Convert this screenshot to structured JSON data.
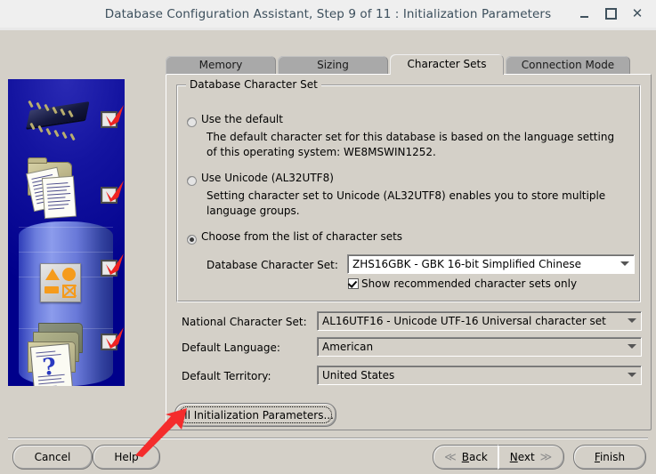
{
  "window": {
    "title": "Database Configuration Assistant, Step 9 of 11 : Initialization Parameters",
    "minimize_label": "",
    "maximize_label": "",
    "close_label": "✕"
  },
  "tabs": [
    {
      "label": "Memory",
      "active": false
    },
    {
      "label": "Sizing",
      "active": false
    },
    {
      "label": "Character Sets",
      "active": true
    },
    {
      "label": "Connection Mode",
      "active": false
    }
  ],
  "group": {
    "title": "Database Character Set",
    "options": [
      {
        "label": "Use the default",
        "selected": false,
        "description": "The default character set for this database is based on the language setting of this operating system: WE8MSWIN1252."
      },
      {
        "label": "Use Unicode (AL32UTF8)",
        "selected": false,
        "description": "Setting character set to Unicode (AL32UTF8) enables you to store multiple language groups."
      },
      {
        "label": "Choose from the list of character sets",
        "selected": true,
        "description": ""
      }
    ],
    "db_charset_label": "Database Character Set:",
    "db_charset_value": "ZHS16GBK - GBK 16-bit Simplified Chinese",
    "show_recommended_label": "Show recommended character sets only",
    "show_recommended_checked": true
  },
  "fields": [
    {
      "label": "National Character Set:",
      "value": "AL16UTF16 - Unicode UTF-16 Universal character set"
    },
    {
      "label": "Default Language:",
      "value": "American"
    },
    {
      "label": "Default Territory:",
      "value": "United States"
    }
  ],
  "all_params_button": "All Initialization Parameters...",
  "footer": {
    "cancel": "Cancel",
    "help": "Help",
    "back": "Back",
    "next": "Next",
    "finish": "Finish",
    "back_chevron": "≪",
    "next_chevron": "≫"
  },
  "side_art": {
    "checkmark_count": 4,
    "question_glyph": "?"
  },
  "colors": {
    "window_bg": "#d4d0c8",
    "titlebar_bg": "#efefef",
    "title_text": "#3c4f5c",
    "tab_inactive": "#a9a9a9",
    "art_blue": "#00008b",
    "annotation_red": "#f42c2c",
    "accent_orange": "#f59b1c"
  }
}
